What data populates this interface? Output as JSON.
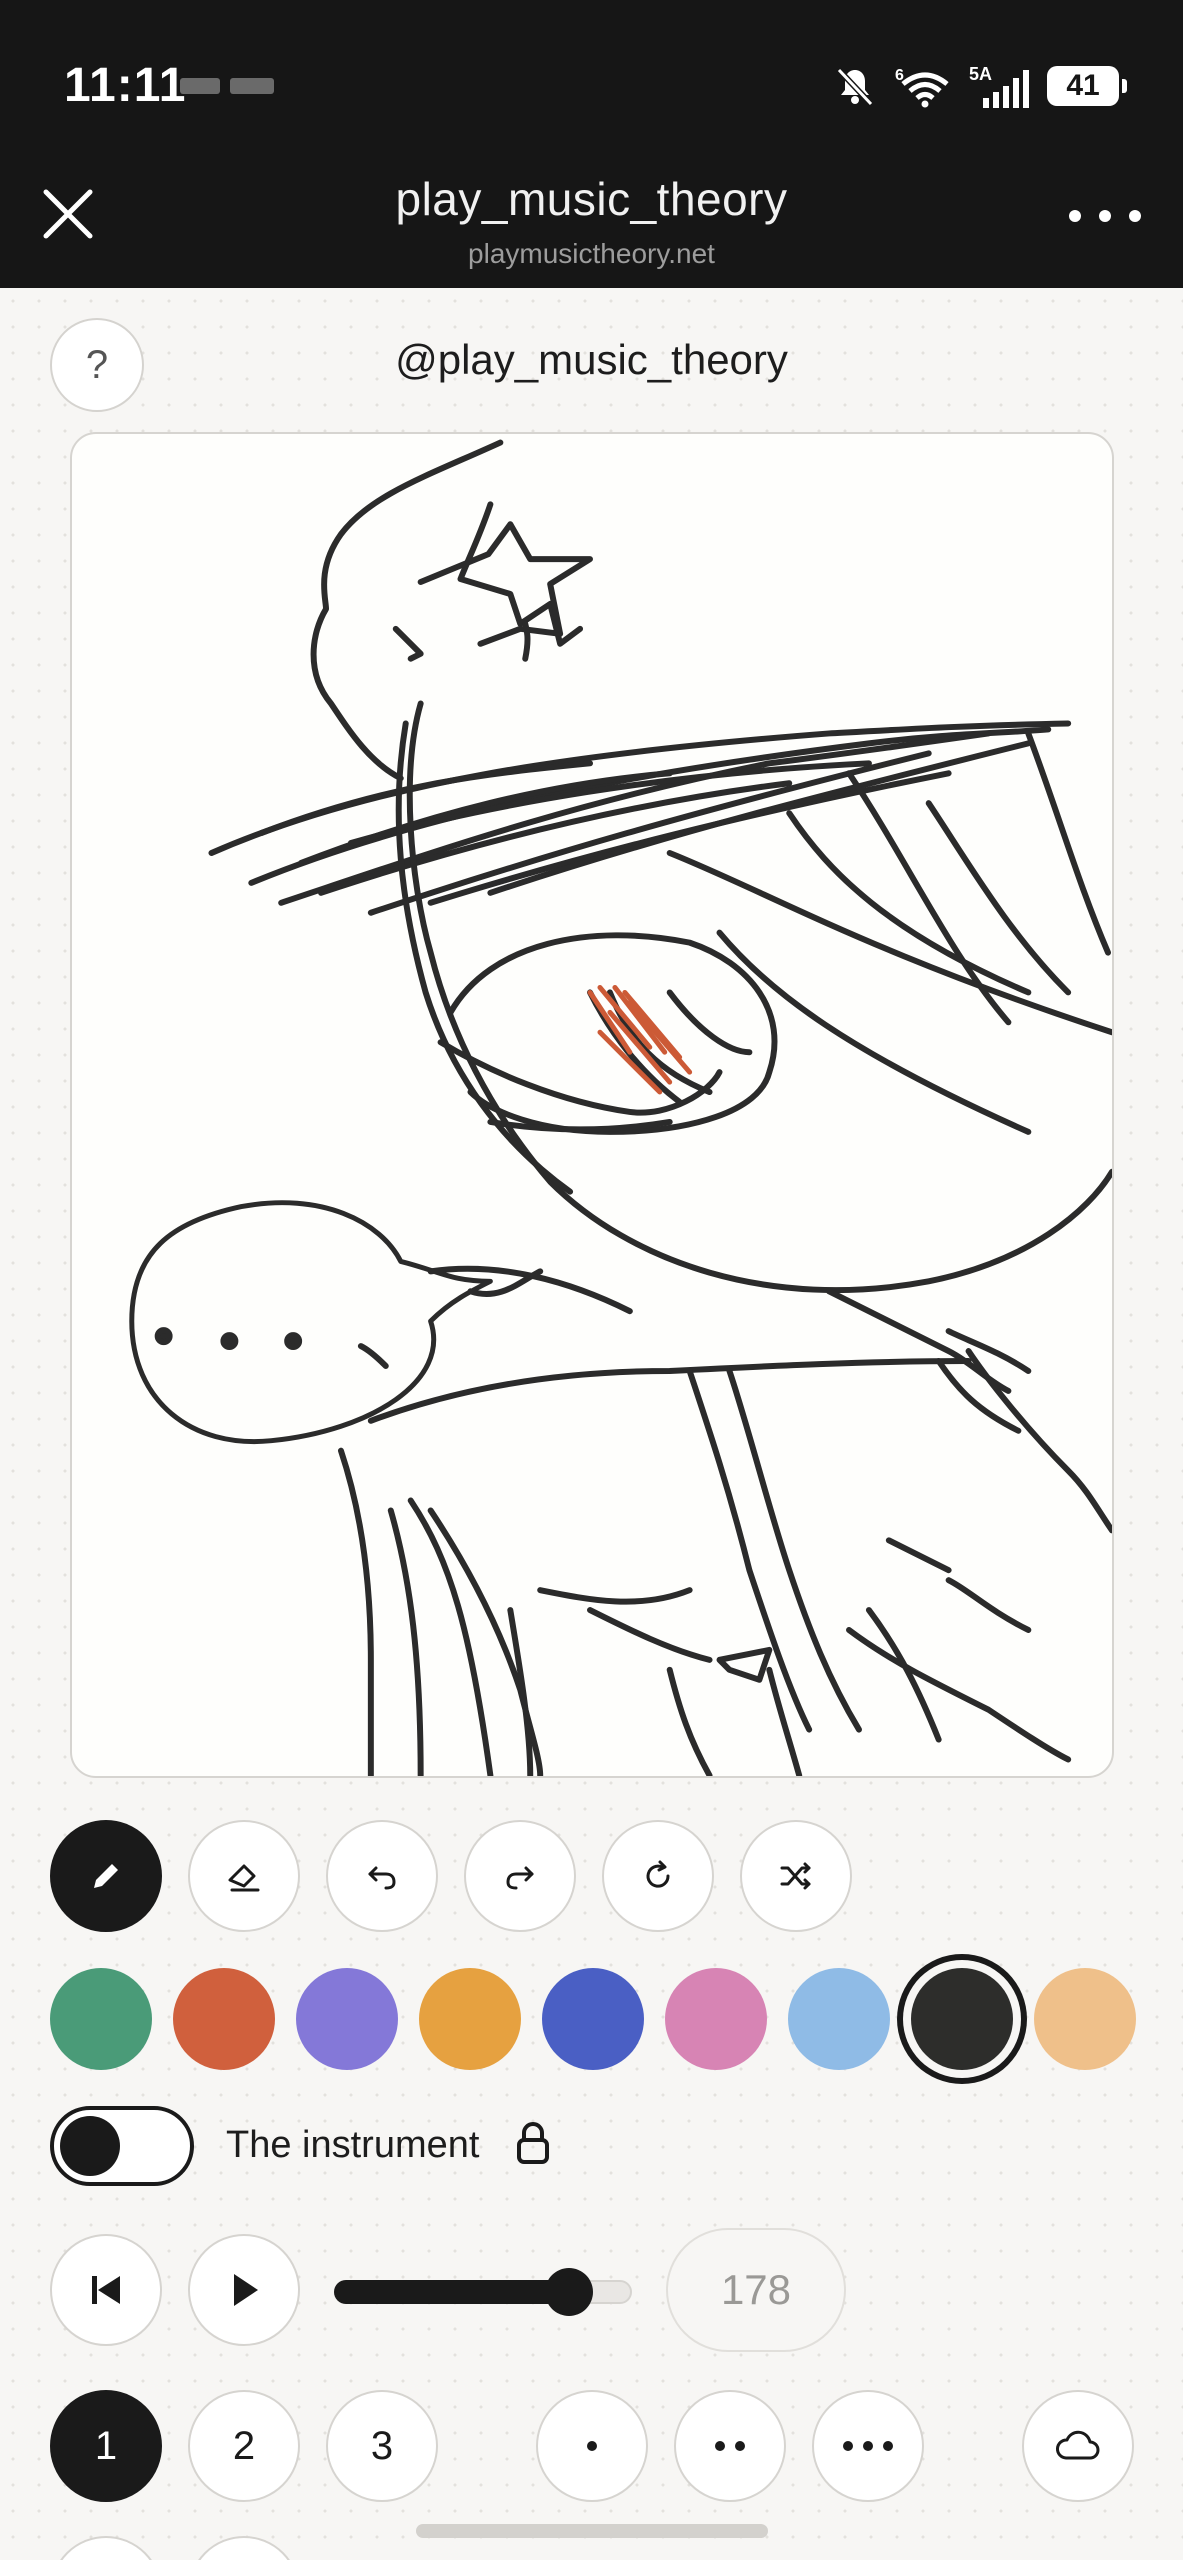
{
  "status_bar": {
    "time": "11:11",
    "signal_label": "5A",
    "battery": "41"
  },
  "title_bar": {
    "title": "play_music_theory",
    "subtitle": "playmusictheory.net"
  },
  "help_label": "?",
  "handle": "@play_music_theory",
  "tools": [
    "pencil-icon",
    "eraser-icon",
    "undo-icon",
    "redo-icon",
    "refresh-icon",
    "shuffle-icon"
  ],
  "palette": [
    {
      "name": "green",
      "color": "#4a9b78"
    },
    {
      "name": "orange-red",
      "color": "#d0603d"
    },
    {
      "name": "lavender",
      "color": "#8478d8"
    },
    {
      "name": "amber",
      "color": "#e6a140"
    },
    {
      "name": "blue",
      "color": "#4a5fc4"
    },
    {
      "name": "pink",
      "color": "#d784b4"
    },
    {
      "name": "light-blue",
      "color": "#8fbbe6"
    },
    {
      "name": "charcoal",
      "color": "#2d2d2b",
      "selected": true
    },
    {
      "name": "peach",
      "color": "#efc08a"
    }
  ],
  "instrument": {
    "label": "The instrument",
    "enabled": false,
    "locked": true
  },
  "playback": {
    "tempo": "178",
    "slider_level": 0.79
  },
  "voices": {
    "labels": [
      "1",
      "2",
      "3"
    ],
    "selected": "1"
  },
  "dot_buttons": [
    "single-dot-icon",
    "double-dot-icon",
    "triple-dot-icon"
  ],
  "cloud_icon": "cloud-icon"
}
